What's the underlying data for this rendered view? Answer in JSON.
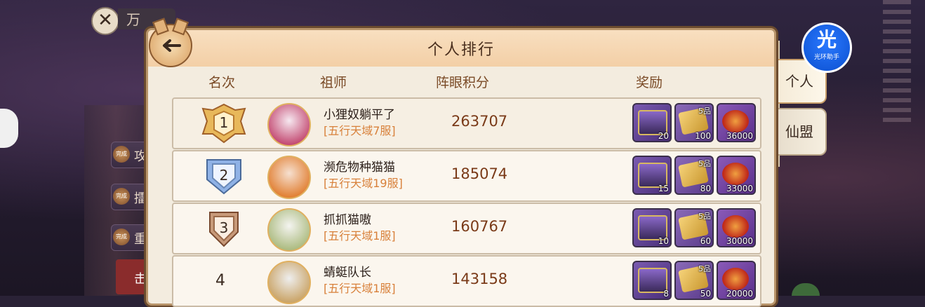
{
  "background": {
    "close_glyph": "✕",
    "title_fragment": "万",
    "side_buttons": [
      {
        "badge": "完成",
        "label": "攻"
      },
      {
        "badge": "完成",
        "label": "擂"
      },
      {
        "badge": "完成",
        "label": "重"
      }
    ],
    "red_button_label": "击"
  },
  "helper": {
    "big": "光",
    "small": "光环助手"
  },
  "panel": {
    "title": "个人排行",
    "columns": {
      "rank": "名次",
      "master": "祖师",
      "score": "阵眼积分",
      "reward": "奖励"
    },
    "rows": [
      {
        "rank": "1",
        "name": "小狸奴躺平了",
        "server": "[五行天域7服]",
        "score": "263707",
        "rewards": {
          "chest": "20",
          "scroll": "100",
          "scroll_grade": "5品",
          "orb": "36000"
        }
      },
      {
        "rank": "2",
        "name": "濒危物种猫猫",
        "server": "[五行天域19服]",
        "score": "185074",
        "rewards": {
          "chest": "15",
          "scroll": "80",
          "scroll_grade": "5品",
          "orb": "33000"
        }
      },
      {
        "rank": "3",
        "name": "抓抓猫嗷",
        "server": "[五行天域1服]",
        "score": "160767",
        "rewards": {
          "chest": "10",
          "scroll": "60",
          "scroll_grade": "5品",
          "orb": "30000"
        }
      },
      {
        "rank": "4",
        "name": "蜻蜓队长",
        "server": "[五行天域1服]",
        "score": "143158",
        "rewards": {
          "chest": "8",
          "scroll": "50",
          "scroll_grade": "5品",
          "orb": "20000"
        }
      }
    ]
  },
  "tabs": {
    "personal": "个人",
    "guild": "仙盟"
  },
  "colors": {
    "gold_medal": "#e8b85a",
    "silver_medal": "#8fb2e6",
    "bronze_medal": "#c89a7a",
    "score_text": "#7a3a18",
    "server_text": "#d8803a"
  }
}
